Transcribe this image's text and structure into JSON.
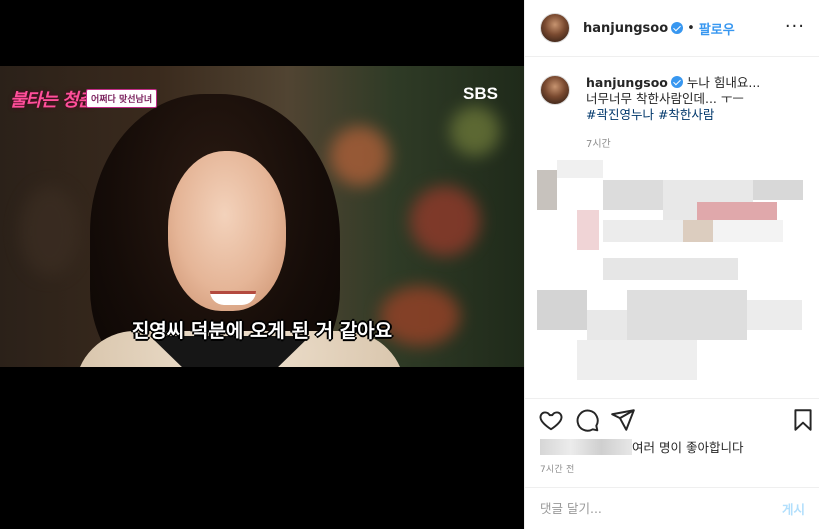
{
  "media": {
    "show_title": "불타는 청춘",
    "show_tag": "어쩌다 맞선남녀",
    "network_logo": "SBS",
    "subtitle": "진영씨 덕분에 오게 된 거 같아요"
  },
  "header": {
    "username": "hanjungsoo",
    "follow_label": "팔로우",
    "more_label": "···",
    "avatar_icon": "profile-avatar-icon",
    "verified_icon": "verified-badge-icon"
  },
  "caption": {
    "username": "hanjungsoo",
    "line1": "누나 힘내요...",
    "line2": "너무너무 착한사람인데... ㅜㅡ",
    "hashtags": "#곽진영누나 #착한사람",
    "time": "7시간"
  },
  "actions": {
    "icons": [
      "heart-icon",
      "comment-icon",
      "share-icon",
      "bookmark-icon"
    ],
    "likes_suffix": "여러 명이 좋아합니다",
    "time": "7시간 전"
  },
  "comment_box": {
    "placeholder": "댓글 달기...",
    "post_label": "게시"
  },
  "colors": {
    "accent": "#3897f0",
    "link": "#00376b",
    "muted": "#8e8e8e",
    "post_disabled": "#b2dffc"
  }
}
